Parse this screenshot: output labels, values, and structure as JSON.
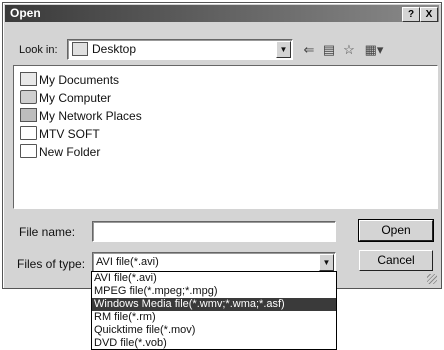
{
  "dialog": {
    "title": "Open",
    "help_btn": "?",
    "close_btn": "X"
  },
  "lookin": {
    "label": "Look in:",
    "value": "Desktop"
  },
  "files": [
    {
      "name": "My Documents",
      "icon": "documents-icon"
    },
    {
      "name": "My Computer",
      "icon": "computer-icon"
    },
    {
      "name": "My Network Places",
      "icon": "network-icon"
    },
    {
      "name": "MTV SOFT",
      "icon": "folder-icon"
    },
    {
      "name": "New Folder",
      "icon": "folder-icon"
    }
  ],
  "filename": {
    "label": "File name:",
    "value": ""
  },
  "filetype": {
    "label": "Files of type:",
    "value": "AVI file(*.avi)",
    "options": [
      "AVI file(*.avi)",
      "MPEG file(*.mpeg;*.mpg)",
      "Windows Media file(*.wmv;*.wma;*.asf)",
      "RM file(*.rm)",
      "Quicktime file(*.mov)",
      "DVD file(*.vob)"
    ],
    "selected_index": 2
  },
  "buttons": {
    "open": "Open",
    "cancel": "Cancel"
  }
}
